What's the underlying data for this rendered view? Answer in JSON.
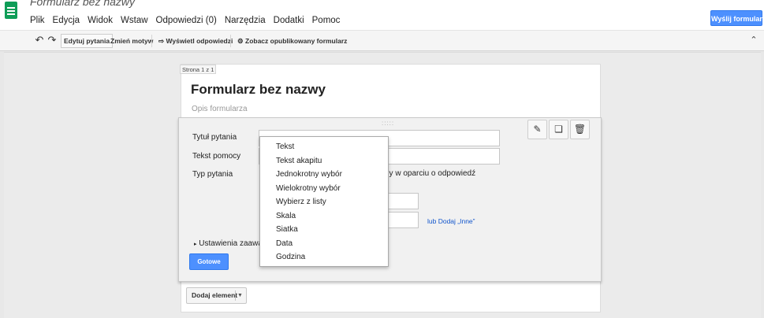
{
  "app": {
    "title": "Formularz bez nazwy",
    "logo": "google-forms-logo",
    "send_button": "Wyślij formularz"
  },
  "menu": [
    "Plik",
    "Edycja",
    "Widok",
    "Wstaw",
    "Odpowiedzi (0)",
    "Narzędzia",
    "Dodatki",
    "Pomoc"
  ],
  "toolbar": {
    "undo_icon": "undo-icon",
    "redo_icon": "redo-icon",
    "edit_questions": "Edytuj pytania",
    "change_theme": "Zmień motyw",
    "view_responses": "Wyświetl odpowiedzi",
    "view_published": "Zobacz opublikowany formularz",
    "collapse_icon": "chevron-up-icon"
  },
  "form": {
    "page_label": "Strona 1 z 1",
    "title": "Formularz bez nazwy",
    "description_placeholder": "Opis formularza"
  },
  "question": {
    "title_label": "Tytuł pytania",
    "help_label": "Tekst pomocy",
    "type_label": "Typ pytania",
    "page_nav_text": "ny w oparciu o odpowiedź",
    "add_other_link": "lub Dodaj „Inne”",
    "advanced_label": "Ustawienia zaawan",
    "done_button": "Gotowe",
    "actions": [
      "pencil-icon",
      "copy-icon",
      "trash-icon"
    ]
  },
  "add_element": {
    "label": "Dodaj element"
  },
  "type_dropdown": [
    "Tekst",
    "Tekst akapitu",
    "Jednokrotny wybór",
    "Wielokrotny wybór",
    "Wybierz z listy",
    "Skala",
    "Siatka",
    "Data",
    "Godzina"
  ],
  "colors": {
    "accent": "#4d90fe",
    "brand": "#0f9d58",
    "link": "#1155cc"
  }
}
